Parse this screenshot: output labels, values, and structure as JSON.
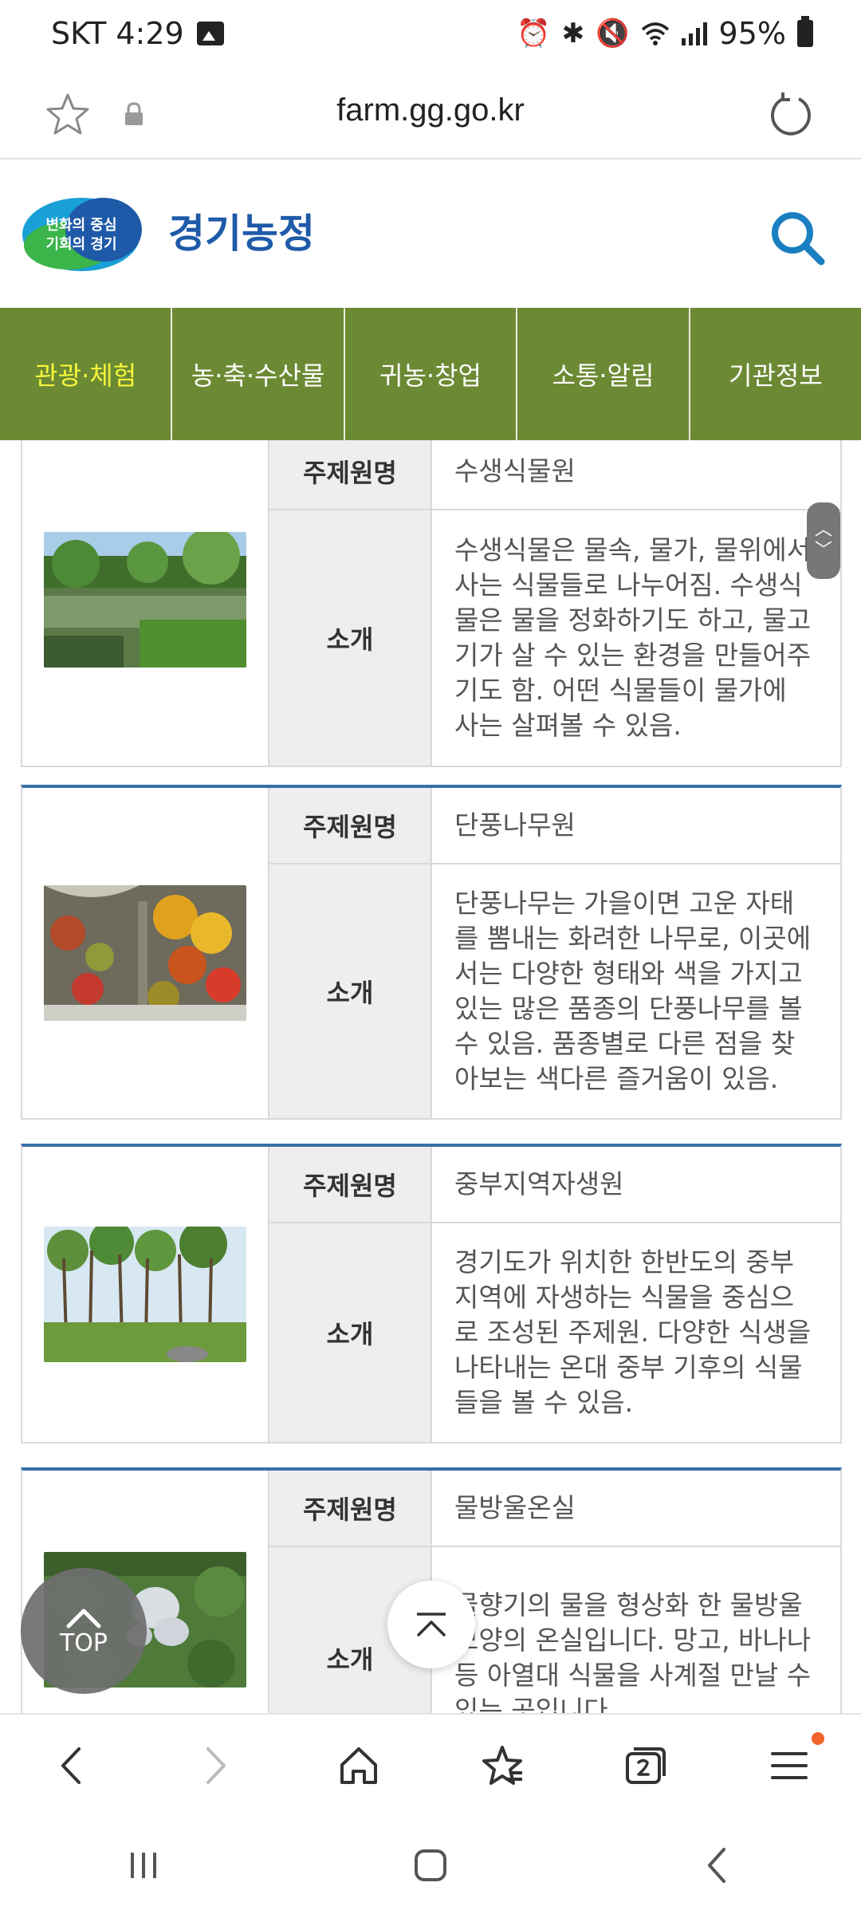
{
  "status_bar": {
    "carrier_time": "SKT 4:29",
    "battery": "95%"
  },
  "browser": {
    "url": "farm.gg.go.kr"
  },
  "site": {
    "logo_slogan_line1": "변화의 중심",
    "logo_slogan_line2": "기회의 경기",
    "logo_name": "경기농정"
  },
  "nav": {
    "items": [
      {
        "label": "관광·체험"
      },
      {
        "label": "농·축·수산물"
      },
      {
        "label": "귀농·창업"
      },
      {
        "label": "소통·알림"
      },
      {
        "label": "기관정보"
      }
    ]
  },
  "gardens": [
    {
      "name_label": "주제원명",
      "name": "수생식물원",
      "desc_label": "소개",
      "desc": "수생식물은 물속, 물가, 물위에서 사는 식물들로 나누어짐. 수생식물은 물을 정화하기도 하고, 물고기가 살 수 있는 환경을 만들어주기도 함. 어떤 식물들이 물가에 사는 살펴볼 수 있음."
    },
    {
      "name_label": "주제원명",
      "name": "단풍나무원",
      "desc_label": "소개",
      "desc": "단풍나무는 가을이면 고운 자태를 뽐내는 화려한 나무로, 이곳에서는 다양한 형태와 색을 가지고 있는 많은 품종의 단풍나무를 볼 수 있음. 품종별로 다른 점을 찾아보는 색다른 즐거움이 있음."
    },
    {
      "name_label": "주제원명",
      "name": "중부지역자생원",
      "desc_label": "소개",
      "desc": "경기도가 위치한 한반도의 중부지역에 자생하는 식물을 중심으로 조성된 주제원. 다양한 식생을 나타내는 온대 중부 기후의 식물들을 볼 수 있음."
    },
    {
      "name_label": "주제원명",
      "name": "물방울온실",
      "desc_label": "소개",
      "desc": "물향기의 물을 형상화 한 물방울 모양의 온실입니다. 망고, 바나나 등 아열대 식물을 사계절 만날 수 있는 곳입니다."
    }
  ],
  "floating": {
    "top_label": "TOP"
  },
  "colors": {
    "nav_green": "#6c8a34",
    "active_nav_text": "#f5f53a",
    "card_top_border": "#3a6fa8",
    "search_blue": "#1a7fc1"
  }
}
